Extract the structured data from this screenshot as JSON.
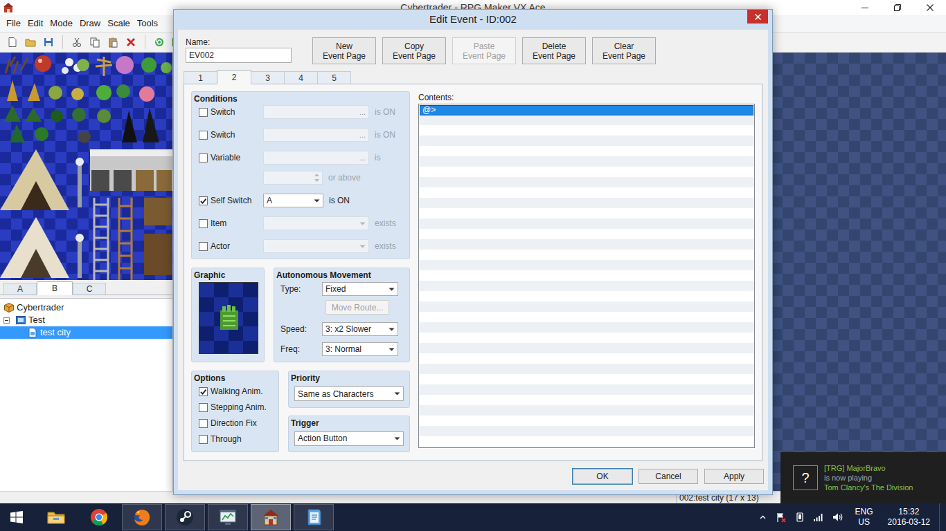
{
  "main_window": {
    "title": "Cybertrader - RPG Maker VX Ace",
    "menu": [
      "File",
      "Edit",
      "Mode",
      "Draw",
      "Scale",
      "Tools"
    ],
    "tileset_tabs": [
      {
        "label": "A",
        "selected": false
      },
      {
        "label": "B",
        "selected": true
      },
      {
        "label": "C",
        "selected": false
      }
    ],
    "map_tree": [
      {
        "label": "Cybertrader",
        "kind": "project",
        "selected": false,
        "children": [
          {
            "label": "Test",
            "kind": "folder",
            "expanded": true,
            "selected": false,
            "children": [
              {
                "label": "test city",
                "kind": "map",
                "selected": true,
                "children": []
              }
            ]
          }
        ]
      }
    ],
    "status_bar": "002:test city (17 x 13)"
  },
  "dialog": {
    "title": "Edit Event - ID:002",
    "name_label": "Name:",
    "name_value": "EV002",
    "page_buttons": [
      {
        "lines": [
          "New",
          "Event Page"
        ],
        "disabled": false
      },
      {
        "lines": [
          "Copy",
          "Event Page"
        ],
        "disabled": false
      },
      {
        "lines": [
          "Paste",
          "Event Page"
        ],
        "disabled": true
      },
      {
        "lines": [
          "Delete",
          "Event Page"
        ],
        "disabled": false
      },
      {
        "lines": [
          "Clear",
          "Event Page"
        ],
        "disabled": false
      }
    ],
    "page_tabs": [
      {
        "label": "1",
        "selected": false
      },
      {
        "label": "2",
        "selected": true
      },
      {
        "label": "3",
        "selected": false
      },
      {
        "label": "4",
        "selected": false
      },
      {
        "label": "5",
        "selected": false
      }
    ],
    "conditions": {
      "title": "Conditions",
      "rows": [
        {
          "kind": "switch",
          "label": "Switch",
          "checked": false,
          "disabled": true,
          "browse": "...",
          "suffix": "is ON"
        },
        {
          "kind": "switch",
          "label": "Switch",
          "checked": false,
          "disabled": true,
          "browse": "...",
          "suffix": "is ON"
        },
        {
          "kind": "variable",
          "label": "Variable",
          "checked": false,
          "disabled": true,
          "browse": "...",
          "suffix": "is",
          "amount_suffix": "or above"
        },
        {
          "kind": "self-switch",
          "label": "Self Switch",
          "checked": true,
          "disabled": false,
          "value": "A",
          "suffix": "is ON"
        },
        {
          "kind": "select",
          "label": "Item",
          "checked": false,
          "disabled": true,
          "suffix": "exists"
        },
        {
          "kind": "select",
          "label": "Actor",
          "checked": false,
          "disabled": true,
          "suffix": "exists"
        }
      ]
    },
    "graphic": {
      "title": "Graphic"
    },
    "movement": {
      "title": "Autonomous Movement",
      "type": {
        "label": "Type:",
        "value": "Fixed"
      },
      "route_button": {
        "label": "Move Route...",
        "disabled": true
      },
      "speed": {
        "label": "Speed:",
        "value": "3: x2 Slower"
      },
      "freq": {
        "label": "Freq:",
        "value": "3: Normal"
      }
    },
    "options": {
      "title": "Options",
      "items": [
        {
          "label": "Walking Anim.",
          "checked": true
        },
        {
          "label": "Stepping Anim.",
          "checked": false
        },
        {
          "label": "Direction Fix",
          "checked": false
        },
        {
          "label": "Through",
          "checked": false
        }
      ]
    },
    "priority": {
      "title": "Priority",
      "value": "Same as Characters"
    },
    "trigger": {
      "title": "Trigger",
      "value": "Action Button"
    },
    "contents": {
      "label": "Contents:",
      "rows": [
        {
          "text": "@>",
          "selected": true
        }
      ]
    },
    "buttons": [
      "OK",
      "Cancel",
      "Apply"
    ]
  },
  "taskbar": {
    "apps": [
      {
        "kind": "explorer",
        "running": false,
        "active": false
      },
      {
        "kind": "chrome",
        "running": false,
        "active": false
      },
      {
        "kind": "firefox",
        "running": true,
        "active": false
      },
      {
        "kind": "steam",
        "running": true,
        "active": false
      },
      {
        "kind": "monitor",
        "running": true,
        "active": false
      },
      {
        "kind": "rpg-maker",
        "running": true,
        "active": true
      },
      {
        "kind": "notes",
        "running": true,
        "active": false
      }
    ],
    "language": "ENG",
    "layout": "US",
    "time": "15:32",
    "date": "2016-03-12"
  },
  "notification": {
    "icon": "?",
    "user": "[TRG] MajorBravo",
    "action": "is now playing",
    "game": "Tom Clancy's The Division"
  }
}
